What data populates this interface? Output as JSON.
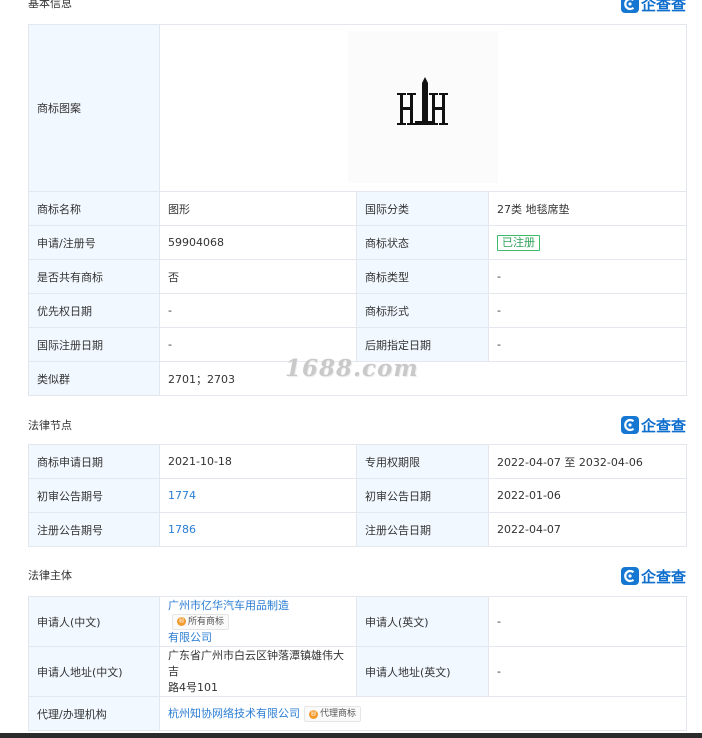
{
  "brand": "企查查",
  "watermark": "1688.com",
  "basic": {
    "title": "基本信息",
    "trademark_image_label": "商标图案",
    "rows": [
      {
        "l1": "商标名称",
        "v1": "图形",
        "l2": "国际分类",
        "v2": "27类 地毯席垫"
      },
      {
        "l1": "申请/注册号",
        "v1": "59904068",
        "l2": "商标状态",
        "v2": "已注册"
      },
      {
        "l1": "是否共有商标",
        "v1": "否",
        "l2": "商标类型",
        "v2": "-"
      },
      {
        "l1": "优先权日期",
        "v1": "-",
        "l2": "商标形式",
        "v2": "-"
      },
      {
        "l1": "国际注册日期",
        "v1": "-",
        "l2": "后期指定日期",
        "v2": "-"
      }
    ],
    "similar_group_label": "类似群",
    "similar_group_value": "2701；2703"
  },
  "legal_nodes": {
    "title": "法律节点",
    "rows": [
      {
        "l1": "商标申请日期",
        "v1": "2021-10-18",
        "l2": "专用权期限",
        "v2": "2022-04-07 至 2032-04-06"
      },
      {
        "l1": "初审公告期号",
        "v1": "1774",
        "l2": "初审公告日期",
        "v2": "2022-01-06"
      },
      {
        "l1": "注册公告期号",
        "v1": "1786",
        "l2": "注册公告日期",
        "v2": "2022-04-07"
      }
    ]
  },
  "legal_entity": {
    "title": "法律主体",
    "applicant_cn_label": "申请人(中文)",
    "applicant_cn_line1": "广州市亿华汽车用品制造",
    "applicant_cn_line2": "有限公司",
    "applicant_tag": "所有商标",
    "applicant_en_label": "申请人(英文)",
    "applicant_en_value": "-",
    "address_cn_label": "申请人地址(中文)",
    "address_cn_line1": "广东省广州市白云区钟落潭镇雄伟大吉",
    "address_cn_line2": "路4号101",
    "address_en_label": "申请人地址(英文)",
    "address_en_value": "-",
    "agent_label": "代理/办理机构",
    "agent_value": "杭州知协网络技术有限公司",
    "agent_tag": "代理商标"
  },
  "colors": {
    "label_bg": "#f2f8ff",
    "border": "#e4e8ee",
    "link": "#2a7dd3",
    "brand": "#0f6fce",
    "status_green": "#2ea35a"
  }
}
